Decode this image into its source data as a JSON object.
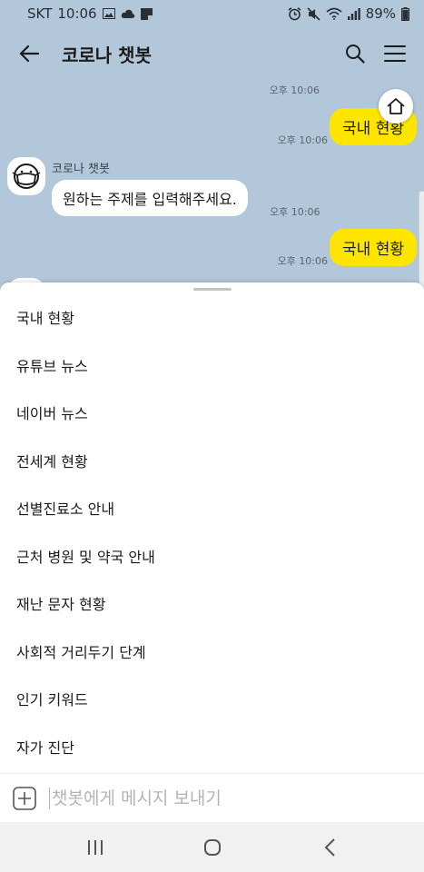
{
  "status_bar": {
    "carrier": "SKT",
    "time": "10:06",
    "battery": "89%",
    "left_icons": [
      "gallery-icon",
      "cloud-icon",
      "note-icon"
    ],
    "right_icons": [
      "alarm-icon",
      "mute-icon",
      "wifi-icon",
      "signal-icon",
      "battery-icon"
    ]
  },
  "header": {
    "back_icon": "back-arrow-icon",
    "title": "코로나 챗봇",
    "search_icon": "search-icon",
    "menu_icon": "hamburger-menu-icon"
  },
  "chat": {
    "sender_name": "코로나 챗봇",
    "messages": [
      {
        "from": "me",
        "text": "",
        "time": "오후 10:06"
      },
      {
        "from": "me",
        "text": "국내 현황",
        "time": "오후 10:06"
      },
      {
        "from": "bot",
        "text": "원하는 주제를 입력해주세요.",
        "time": "오후 10:06"
      },
      {
        "from": "me",
        "text": "국내 현황",
        "time": "오후 10:06"
      }
    ],
    "home_icon": "home-icon"
  },
  "menu_sheet": {
    "items": [
      "국내 현황",
      "유튜브 뉴스",
      "네이버 뉴스",
      "전세계 현황",
      "선별진료소 안내",
      "근처 병원 및 약국 안내",
      "재난 문자 현황",
      "사회적 거리두기 단계",
      "인기 키워드",
      "자가 진단"
    ]
  },
  "input_bar": {
    "plus_icon": "plus-square-icon",
    "placeholder": "챗봇에게 메시지 보내기",
    "value": ""
  },
  "nav_bar": {
    "icons": [
      "recent-apps-icon",
      "home-button-icon",
      "back-icon"
    ]
  },
  "colors": {
    "chat_background": "#b2c7d9",
    "my_bubble": "#fee500",
    "bot_bubble": "#ffffff"
  }
}
